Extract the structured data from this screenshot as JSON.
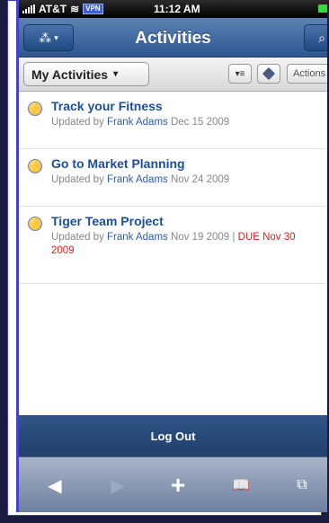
{
  "statusbar": {
    "carrier": "AT&T",
    "vpn": "VPN",
    "time": "11:12 AM"
  },
  "navbar": {
    "title": "Activities",
    "menu_icon": "network-icon",
    "search_icon": "search-icon"
  },
  "toolbar": {
    "filter_label": "My Activities",
    "actions_label": "Actions"
  },
  "activities": [
    {
      "title": "Track your Fitness",
      "updated_prefix": "Updated by",
      "user": "Frank Adams",
      "date": "Dec 15 2009",
      "due": ""
    },
    {
      "title": "Go to Market Planning",
      "updated_prefix": "Updated by",
      "user": "Frank Adams",
      "date": "Nov 24 2009",
      "due": ""
    },
    {
      "title": "Tiger Team Project",
      "updated_prefix": "Updated by",
      "user": "Frank Adams",
      "date": "Nov 19 2009",
      "separator": "|",
      "due": "DUE Nov 30 2009"
    }
  ],
  "footer": {
    "logout_label": "Log Out"
  },
  "colors": {
    "nav_blue": "#2d5690",
    "link_blue": "#1c4e9e",
    "due_red": "#e01c1c"
  }
}
